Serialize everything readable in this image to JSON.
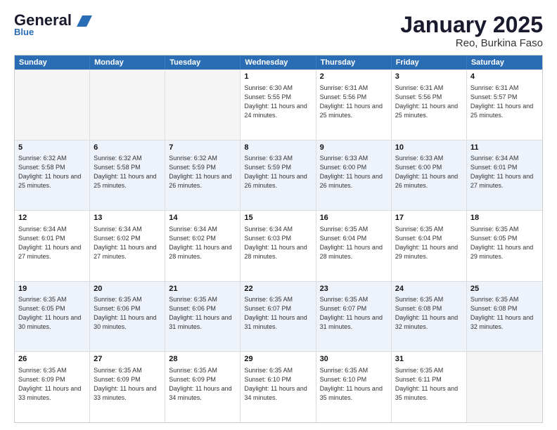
{
  "header": {
    "logo_general": "General",
    "logo_blue": "Blue",
    "title": "January 2025",
    "subtitle": "Reo, Burkina Faso"
  },
  "weekdays": [
    "Sunday",
    "Monday",
    "Tuesday",
    "Wednesday",
    "Thursday",
    "Friday",
    "Saturday"
  ],
  "rows": [
    {
      "alt": false,
      "cells": [
        {
          "day": "",
          "sunrise": "",
          "sunset": "",
          "daylight": "",
          "empty": true
        },
        {
          "day": "",
          "sunrise": "",
          "sunset": "",
          "daylight": "",
          "empty": true
        },
        {
          "day": "",
          "sunrise": "",
          "sunset": "",
          "daylight": "",
          "empty": true
        },
        {
          "day": "1",
          "sunrise": "Sunrise: 6:30 AM",
          "sunset": "Sunset: 5:55 PM",
          "daylight": "Daylight: 11 hours and 24 minutes.",
          "empty": false
        },
        {
          "day": "2",
          "sunrise": "Sunrise: 6:31 AM",
          "sunset": "Sunset: 5:56 PM",
          "daylight": "Daylight: 11 hours and 25 minutes.",
          "empty": false
        },
        {
          "day": "3",
          "sunrise": "Sunrise: 6:31 AM",
          "sunset": "Sunset: 5:56 PM",
          "daylight": "Daylight: 11 hours and 25 minutes.",
          "empty": false
        },
        {
          "day": "4",
          "sunrise": "Sunrise: 6:31 AM",
          "sunset": "Sunset: 5:57 PM",
          "daylight": "Daylight: 11 hours and 25 minutes.",
          "empty": false
        }
      ]
    },
    {
      "alt": true,
      "cells": [
        {
          "day": "5",
          "sunrise": "Sunrise: 6:32 AM",
          "sunset": "Sunset: 5:58 PM",
          "daylight": "Daylight: 11 hours and 25 minutes.",
          "empty": false
        },
        {
          "day": "6",
          "sunrise": "Sunrise: 6:32 AM",
          "sunset": "Sunset: 5:58 PM",
          "daylight": "Daylight: 11 hours and 25 minutes.",
          "empty": false
        },
        {
          "day": "7",
          "sunrise": "Sunrise: 6:32 AM",
          "sunset": "Sunset: 5:59 PM",
          "daylight": "Daylight: 11 hours and 26 minutes.",
          "empty": false
        },
        {
          "day": "8",
          "sunrise": "Sunrise: 6:33 AM",
          "sunset": "Sunset: 5:59 PM",
          "daylight": "Daylight: 11 hours and 26 minutes.",
          "empty": false
        },
        {
          "day": "9",
          "sunrise": "Sunrise: 6:33 AM",
          "sunset": "Sunset: 6:00 PM",
          "daylight": "Daylight: 11 hours and 26 minutes.",
          "empty": false
        },
        {
          "day": "10",
          "sunrise": "Sunrise: 6:33 AM",
          "sunset": "Sunset: 6:00 PM",
          "daylight": "Daylight: 11 hours and 26 minutes.",
          "empty": false
        },
        {
          "day": "11",
          "sunrise": "Sunrise: 6:34 AM",
          "sunset": "Sunset: 6:01 PM",
          "daylight": "Daylight: 11 hours and 27 minutes.",
          "empty": false
        }
      ]
    },
    {
      "alt": false,
      "cells": [
        {
          "day": "12",
          "sunrise": "Sunrise: 6:34 AM",
          "sunset": "Sunset: 6:01 PM",
          "daylight": "Daylight: 11 hours and 27 minutes.",
          "empty": false
        },
        {
          "day": "13",
          "sunrise": "Sunrise: 6:34 AM",
          "sunset": "Sunset: 6:02 PM",
          "daylight": "Daylight: 11 hours and 27 minutes.",
          "empty": false
        },
        {
          "day": "14",
          "sunrise": "Sunrise: 6:34 AM",
          "sunset": "Sunset: 6:02 PM",
          "daylight": "Daylight: 11 hours and 28 minutes.",
          "empty": false
        },
        {
          "day": "15",
          "sunrise": "Sunrise: 6:34 AM",
          "sunset": "Sunset: 6:03 PM",
          "daylight": "Daylight: 11 hours and 28 minutes.",
          "empty": false
        },
        {
          "day": "16",
          "sunrise": "Sunrise: 6:35 AM",
          "sunset": "Sunset: 6:04 PM",
          "daylight": "Daylight: 11 hours and 28 minutes.",
          "empty": false
        },
        {
          "day": "17",
          "sunrise": "Sunrise: 6:35 AM",
          "sunset": "Sunset: 6:04 PM",
          "daylight": "Daylight: 11 hours and 29 minutes.",
          "empty": false
        },
        {
          "day": "18",
          "sunrise": "Sunrise: 6:35 AM",
          "sunset": "Sunset: 6:05 PM",
          "daylight": "Daylight: 11 hours and 29 minutes.",
          "empty": false
        }
      ]
    },
    {
      "alt": true,
      "cells": [
        {
          "day": "19",
          "sunrise": "Sunrise: 6:35 AM",
          "sunset": "Sunset: 6:05 PM",
          "daylight": "Daylight: 11 hours and 30 minutes.",
          "empty": false
        },
        {
          "day": "20",
          "sunrise": "Sunrise: 6:35 AM",
          "sunset": "Sunset: 6:06 PM",
          "daylight": "Daylight: 11 hours and 30 minutes.",
          "empty": false
        },
        {
          "day": "21",
          "sunrise": "Sunrise: 6:35 AM",
          "sunset": "Sunset: 6:06 PM",
          "daylight": "Daylight: 11 hours and 31 minutes.",
          "empty": false
        },
        {
          "day": "22",
          "sunrise": "Sunrise: 6:35 AM",
          "sunset": "Sunset: 6:07 PM",
          "daylight": "Daylight: 11 hours and 31 minutes.",
          "empty": false
        },
        {
          "day": "23",
          "sunrise": "Sunrise: 6:35 AM",
          "sunset": "Sunset: 6:07 PM",
          "daylight": "Daylight: 11 hours and 31 minutes.",
          "empty": false
        },
        {
          "day": "24",
          "sunrise": "Sunrise: 6:35 AM",
          "sunset": "Sunset: 6:08 PM",
          "daylight": "Daylight: 11 hours and 32 minutes.",
          "empty": false
        },
        {
          "day": "25",
          "sunrise": "Sunrise: 6:35 AM",
          "sunset": "Sunset: 6:08 PM",
          "daylight": "Daylight: 11 hours and 32 minutes.",
          "empty": false
        }
      ]
    },
    {
      "alt": false,
      "cells": [
        {
          "day": "26",
          "sunrise": "Sunrise: 6:35 AM",
          "sunset": "Sunset: 6:09 PM",
          "daylight": "Daylight: 11 hours and 33 minutes.",
          "empty": false
        },
        {
          "day": "27",
          "sunrise": "Sunrise: 6:35 AM",
          "sunset": "Sunset: 6:09 PM",
          "daylight": "Daylight: 11 hours and 33 minutes.",
          "empty": false
        },
        {
          "day": "28",
          "sunrise": "Sunrise: 6:35 AM",
          "sunset": "Sunset: 6:09 PM",
          "daylight": "Daylight: 11 hours and 34 minutes.",
          "empty": false
        },
        {
          "day": "29",
          "sunrise": "Sunrise: 6:35 AM",
          "sunset": "Sunset: 6:10 PM",
          "daylight": "Daylight: 11 hours and 34 minutes.",
          "empty": false
        },
        {
          "day": "30",
          "sunrise": "Sunrise: 6:35 AM",
          "sunset": "Sunset: 6:10 PM",
          "daylight": "Daylight: 11 hours and 35 minutes.",
          "empty": false
        },
        {
          "day": "31",
          "sunrise": "Sunrise: 6:35 AM",
          "sunset": "Sunset: 6:11 PM",
          "daylight": "Daylight: 11 hours and 35 minutes.",
          "empty": false
        },
        {
          "day": "",
          "sunrise": "",
          "sunset": "",
          "daylight": "",
          "empty": true
        }
      ]
    }
  ]
}
